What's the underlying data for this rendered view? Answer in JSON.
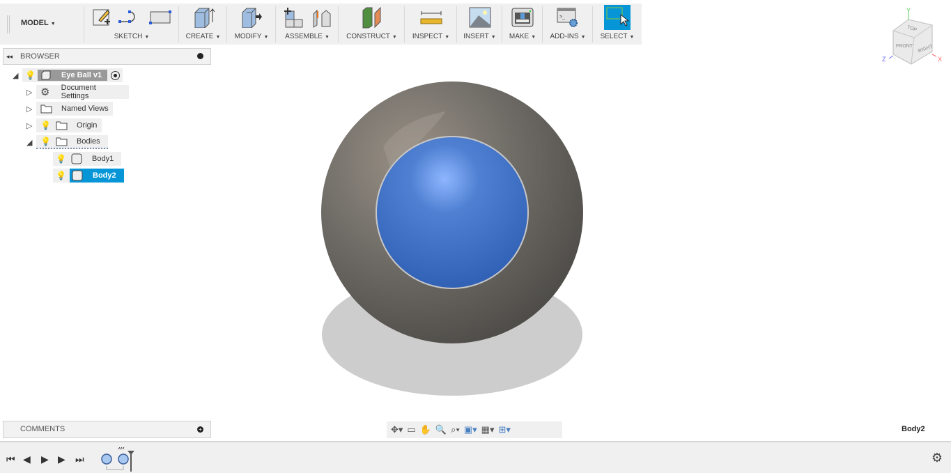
{
  "toolbar": {
    "workspace": "MODEL",
    "groups": [
      {
        "label": "SKETCH"
      },
      {
        "label": "CREATE"
      },
      {
        "label": "MODIFY"
      },
      {
        "label": "ASSEMBLE"
      },
      {
        "label": "CONSTRUCT"
      },
      {
        "label": "INSPECT"
      },
      {
        "label": "INSERT"
      },
      {
        "label": "MAKE"
      },
      {
        "label": "ADD-INS"
      },
      {
        "label": "SELECT"
      }
    ]
  },
  "browser": {
    "title": "BROWSER",
    "root": "Eye Ball v1",
    "items": [
      {
        "label": "Document Settings",
        "icon": "gear-icon"
      },
      {
        "label": "Named Views",
        "icon": "folder-icon"
      },
      {
        "label": "Origin",
        "icon": "folder-icon"
      },
      {
        "label": "Bodies",
        "icon": "folder-icon"
      },
      {
        "label": "Body1",
        "icon": "body-icon"
      },
      {
        "label": "Body2",
        "icon": "body-icon",
        "selected": true
      }
    ]
  },
  "comments": {
    "title": "COMMENTS"
  },
  "viewcube": {
    "top": "TOP",
    "front": "FRONT",
    "right": "RIGHT",
    "x": "X",
    "y": "Y",
    "z": "Z"
  },
  "status": {
    "selection": "Body2"
  },
  "colors": {
    "accent": "#0696d7",
    "iris": "#3b6fc2",
    "ball": "#6e6b66"
  }
}
